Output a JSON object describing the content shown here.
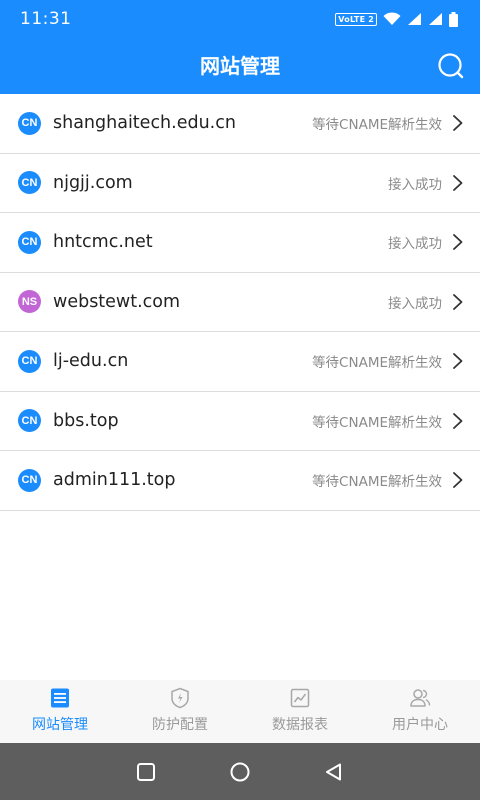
{
  "status_bar": {
    "time": "11:31",
    "volte_label": "VoLTE 2"
  },
  "header": {
    "title": "网站管理",
    "search_icon": "search-icon"
  },
  "sites": [
    {
      "badge": "CN",
      "badge_color": "#1a8cfd",
      "domain": "shanghaitech.edu.cn",
      "status": "等待CNAME解析生效"
    },
    {
      "badge": "CN",
      "badge_color": "#1a8cfd",
      "domain": "njgjj.com",
      "status": "接入成功"
    },
    {
      "badge": "CN",
      "badge_color": "#1a8cfd",
      "domain": "hntcmc.net",
      "status": "接入成功"
    },
    {
      "badge": "NS",
      "badge_color": "#c266d6",
      "domain": "webstewt.com",
      "status": "接入成功"
    },
    {
      "badge": "CN",
      "badge_color": "#1a8cfd",
      "domain": "lj-edu.cn",
      "status": "等待CNAME解析生效"
    },
    {
      "badge": "CN",
      "badge_color": "#1a8cfd",
      "domain": "bbs.top",
      "status": "等待CNAME解析生效"
    },
    {
      "badge": "CN",
      "badge_color": "#1a8cfd",
      "domain": "admin111.top",
      "status": "等待CNAME解析生效"
    }
  ],
  "tabs": [
    {
      "label": "网站管理",
      "icon": "site-list-icon",
      "active": true
    },
    {
      "label": "防护配置",
      "icon": "shield-icon",
      "active": false
    },
    {
      "label": "数据报表",
      "icon": "chart-report-icon",
      "active": false
    },
    {
      "label": "用户中心",
      "icon": "user-icon",
      "active": false
    }
  ],
  "colors": {
    "primary": "#1a8cfd",
    "badge_ns": "#c266d6",
    "inactive_text": "#9a9a9a"
  }
}
